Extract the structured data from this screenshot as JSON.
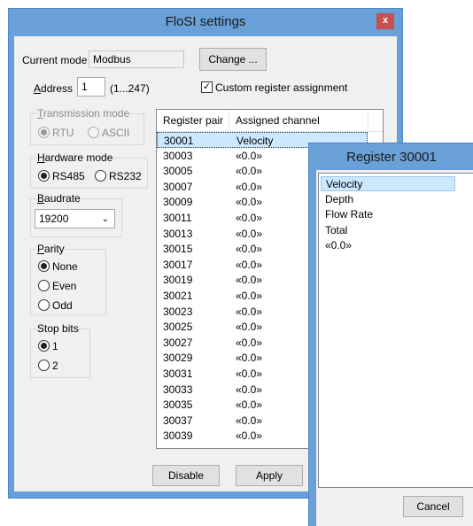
{
  "main_window": {
    "title": "FloSI settings",
    "close_label": "x",
    "current_mode_label": "Current mode",
    "current_mode_value": "Modbus",
    "change_button": "Change ...",
    "address_label_prefix": "A",
    "address_label_rest": "ddress",
    "address_value": "1",
    "address_range": "(1...247)",
    "custom_assignment_label": "Custom register assignment",
    "custom_assignment_checked": true,
    "transmission_mode": {
      "title_u": "T",
      "title_rest": "ransmission mode",
      "options": [
        "RTU",
        "ASCII"
      ]
    },
    "hardware_mode": {
      "title_u": "H",
      "title_rest": "ardware mode",
      "options": [
        "RS485",
        "RS232"
      ]
    },
    "baudrate": {
      "title_u": "B",
      "title_rest": "audrate",
      "value": "19200"
    },
    "parity": {
      "title_u": "P",
      "title_rest": "arity",
      "options": [
        "None",
        "Even",
        "Odd"
      ]
    },
    "stop_bits": {
      "title": "Stop bits",
      "options": [
        "1",
        "2"
      ]
    },
    "table": {
      "headers": [
        "Register pair",
        "Assigned channel"
      ],
      "rows": [
        [
          "30001",
          "Velocity"
        ],
        [
          "30003",
          "«0.0»"
        ],
        [
          "30005",
          "«0.0»"
        ],
        [
          "30007",
          "«0.0»"
        ],
        [
          "30009",
          "«0.0»"
        ],
        [
          "30011",
          "«0.0»"
        ],
        [
          "30013",
          "«0.0»"
        ],
        [
          "30015",
          "«0.0»"
        ],
        [
          "30017",
          "«0.0»"
        ],
        [
          "30019",
          "«0.0»"
        ],
        [
          "30021",
          "«0.0»"
        ],
        [
          "30023",
          "«0.0»"
        ],
        [
          "30025",
          "«0.0»"
        ],
        [
          "30027",
          "«0.0»"
        ],
        [
          "30029",
          "«0.0»"
        ],
        [
          "30031",
          "«0.0»"
        ],
        [
          "30033",
          "«0.0»"
        ],
        [
          "30035",
          "«0.0»"
        ],
        [
          "30037",
          "«0.0»"
        ],
        [
          "30039",
          "«0.0»"
        ]
      ]
    },
    "disable_button": "Disable",
    "apply_button": "Apply"
  },
  "register_dialog": {
    "title": "Register 30001",
    "items": [
      "Velocity",
      "Depth",
      "Flow Rate",
      "Total",
      "«0.0»"
    ],
    "cancel_button": "Cancel"
  },
  "colors": {
    "titlebar": "#6aa0d8",
    "close_button": "#c75050",
    "selection": "#cce8ff"
  }
}
